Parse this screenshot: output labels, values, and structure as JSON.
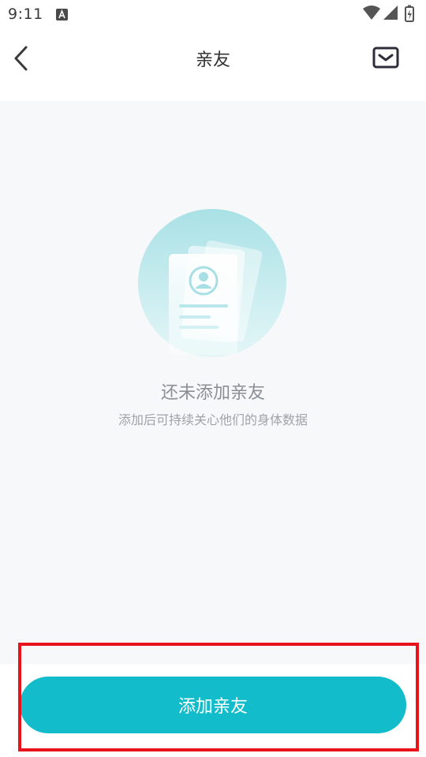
{
  "status_bar": {
    "time": "9:11",
    "icons": [
      "a-notification-icon",
      "wifi-icon",
      "signal-icon",
      "battery-icon"
    ]
  },
  "header": {
    "title": "亲友",
    "back_icon": "chevron-left-icon",
    "message_icon": "mail-icon"
  },
  "empty_state": {
    "title": "还未添加亲友",
    "subtitle": "添加后可持续关心他们的身体数据",
    "illustration": "contact-card-illustration"
  },
  "bottom": {
    "add_button_label": "添加亲友"
  },
  "colors": {
    "accent": "#12bccb",
    "background": "#f7f8fa",
    "highlight": "#e8131a"
  }
}
